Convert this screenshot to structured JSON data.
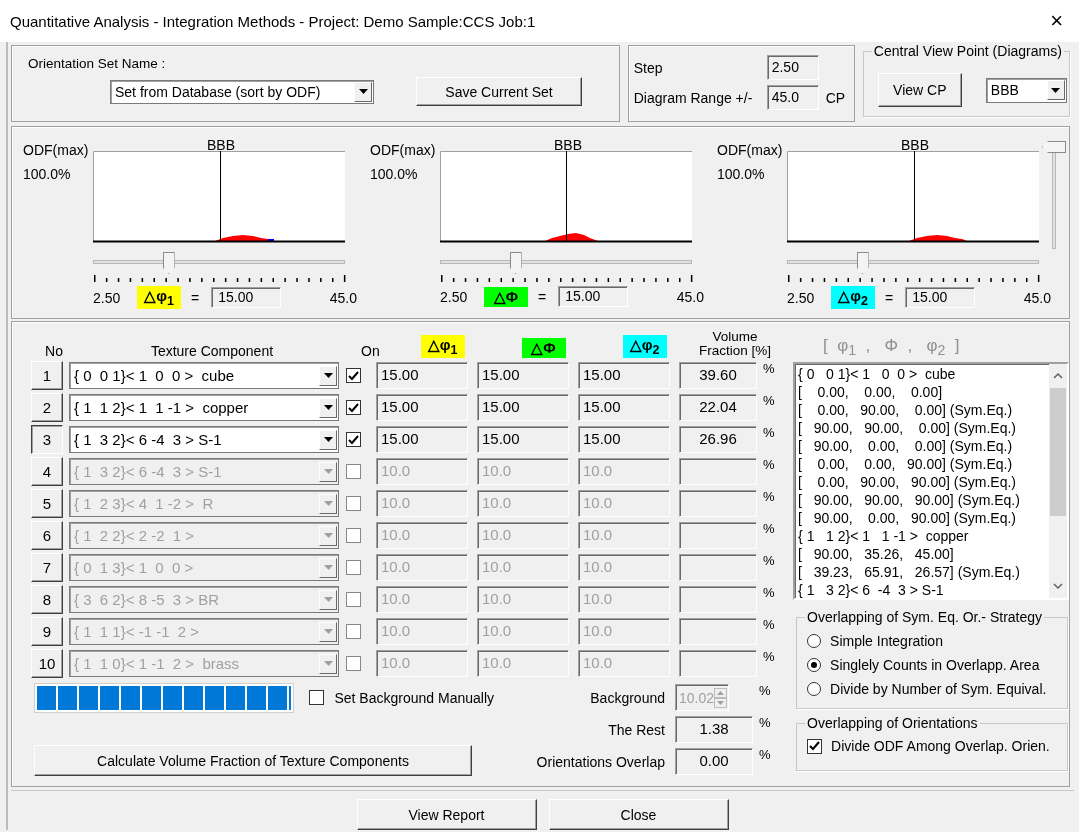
{
  "window": {
    "title": "Quantitative Analysis - Integration Methods - Project: Demo Sample:CCS  Job:1",
    "close": "×"
  },
  "orientation_set": {
    "label": "Orientation Set Name :",
    "value": "Set from Database (sort by ODF)",
    "save_button": "Save Current Set"
  },
  "step": {
    "step_label": "Step",
    "step_value": "2.50",
    "range_label": "Diagram Range +/-",
    "range_value": "45.0",
    "range_unit": "CP"
  },
  "central_view_point": {
    "title": "Central View Point (Diagrams)",
    "button": "View CP",
    "value": "BBB"
  },
  "diagrams": [
    {
      "y_label": "ODF(max)",
      "y_value": "100.0%",
      "center_label": "BBB",
      "min": "2.50",
      "max": "45.0",
      "delta_label": "△φ$_{1}$",
      "color": "#ffff00",
      "equals": "=",
      "value": "15.00",
      "level": 0.3
    },
    {
      "y_label": "ODF(max)",
      "y_value": "100.0%",
      "center_label": "BBB",
      "min": "2.50",
      "max": "45.0",
      "delta_label": "△Φ",
      "color": "#00ff00",
      "equals": "=",
      "value": "15.00",
      "level": 0.3
    },
    {
      "y_label": "ODF(max)",
      "y_value": "100.0%",
      "center_label": "BBB",
      "min": "2.50",
      "max": "45.0",
      "delta_label": "△φ$_{2}$",
      "color": "#00ffff",
      "equals": "=",
      "value": "15.00",
      "level": 0.3
    }
  ],
  "vertical_slider": {
    "level": 1
  },
  "table": {
    "columns": [
      {
        "label": "No"
      },
      {
        "label": "Texture Component"
      },
      {
        "label": "On"
      },
      {
        "label": "△φ$_{1}$",
        "color": "#ffff00"
      },
      {
        "label": "△Φ",
        "color": "#00ff00"
      },
      {
        "label": "△φ$_{2}$",
        "color": "#00ffff"
      },
      {
        "label": "Volume Fraction [%]"
      }
    ],
    "rows": [
      {
        "no": "1",
        "selected": false,
        "component": "{ 0  0 1}< 1  0  0 >  cube",
        "on": true,
        "disabled": false,
        "d_phi1": "15.00",
        "d_Phi": "15.00",
        "d_phi2": "15.00",
        "volume_fraction": "39.60",
        "unit": "%"
      },
      {
        "no": "2",
        "selected": false,
        "component": "{ 1  1 2}< 1  1 -1 >  copper",
        "on": true,
        "disabled": false,
        "d_phi1": "15.00",
        "d_Phi": "15.00",
        "d_phi2": "15.00",
        "volume_fraction": "22.04",
        "unit": "%"
      },
      {
        "no": "3",
        "selected": true,
        "component": "{ 1  3 2}< 6 -4  3 > S-1",
        "on": true,
        "disabled": false,
        "d_phi1": "15.00",
        "d_Phi": "15.00",
        "d_phi2": "15.00",
        "volume_fraction": "26.96",
        "unit": "%"
      },
      {
        "no": "4",
        "selected": false,
        "component": "{ 1  3 2}< 6 -4  3 > S-1",
        "on": false,
        "disabled": true,
        "d_phi1": "10.0",
        "d_Phi": "10.0",
        "d_phi2": "10.0",
        "unit": "%"
      },
      {
        "no": "5",
        "selected": false,
        "component": "{ 1  2 3}< 4  1 -2 >  R",
        "on": false,
        "disabled": true,
        "d_phi1": "10.0",
        "d_Phi": "10.0",
        "d_phi2": "10.0",
        "unit": "%"
      },
      {
        "no": "6",
        "selected": false,
        "component": "{ 1  2 2}< 2 -2  1 >",
        "on": false,
        "disabled": true,
        "d_phi1": "10.0",
        "d_Phi": "10.0",
        "d_phi2": "10.0",
        "unit": "%"
      },
      {
        "no": "7",
        "selected": false,
        "component": "{ 0  1 3}< 1  0  0 >",
        "on": false,
        "disabled": true,
        "d_phi1": "10.0",
        "d_Phi": "10.0",
        "d_phi2": "10.0",
        "unit": "%"
      },
      {
        "no": "8",
        "selected": false,
        "component": "{ 3  6 2}< 8 -5  3 > BR",
        "on": false,
        "disabled": true,
        "d_phi1": "10.0",
        "d_Phi": "10.0",
        "d_phi2": "10.0",
        "unit": "%"
      },
      {
        "no": "9",
        "selected": false,
        "component": "{ 1  1 1}< -1 -1  2 >",
        "on": false,
        "disabled": true,
        "d_phi1": "10.0",
        "d_Phi": "10.0",
        "d_phi2": "10.0",
        "unit": "%"
      },
      {
        "no": "10",
        "selected": false,
        "component": "{ 1  1 0}< 1 -1  2 >  brass",
        "on": false,
        "disabled": true,
        "d_phi1": "10.0",
        "d_Phi": "10.0",
        "d_phi2": "10.0",
        "unit": "%"
      }
    ]
  },
  "euler_list": {
    "header": "[  φ$_{1}$  ,   Φ  ,   φ$_{2}$  ]",
    "lines": [
      "{ 0   0 1}< 1   0  0 >  cube",
      "[    0.00,    0.00,    0.00]",
      "[    0.00,   90.00,    0.00] (Sym.Eq.)",
      "[   90.00,   90.00,    0.00] (Sym.Eq.)",
      "[   90.00,    0.00,    0.00] (Sym.Eq.)",
      "[    0.00,    0.00,   90.00] (Sym.Eq.)",
      "[    0.00,   90.00,   90.00] (Sym.Eq.)",
      "[   90.00,   90.00,   90.00] (Sym.Eq.)",
      "[   90.00,    0.00,   90.00] (Sym.Eq.)",
      "{ 1   1 2}< 1   1 -1 >  copper",
      "[   90.00,   35.26,   45.00]",
      "[   39.23,   65.91,   26.57] (Sym.Eq.)",
      "{ 1   3 2}< 6  -4  3 > S-1"
    ]
  },
  "progress": {
    "level": 1
  },
  "calculate_button": "Calculate Volume Fraction of Texture Components",
  "background": {
    "checkbox_label": "Set Background Manually",
    "checked": false,
    "label": "Background",
    "value": "10.02",
    "disabled": true,
    "unit": "%"
  },
  "the_rest": {
    "label": "The Rest",
    "value": "1.38",
    "unit": "%"
  },
  "orientations_overlap": {
    "label": "Orientations Overlap",
    "value": "0.00",
    "unit": "%"
  },
  "strategy": {
    "title": "Overlapping of Sym. Eq. Or.- Strategy",
    "options": [
      {
        "label": "Simple Integration",
        "selected": false
      },
      {
        "label": "Singlely Counts in Overlapp. Area",
        "selected": true
      },
      {
        "label": "Divide by Number of Sym. Equival.",
        "selected": false
      }
    ]
  },
  "overlap_orientations": {
    "title": "Overlapping of Orientations",
    "label": "Divide ODF Among Overlap. Orien.",
    "checked": true
  },
  "buttons": [
    "View Report",
    "Close"
  ]
}
